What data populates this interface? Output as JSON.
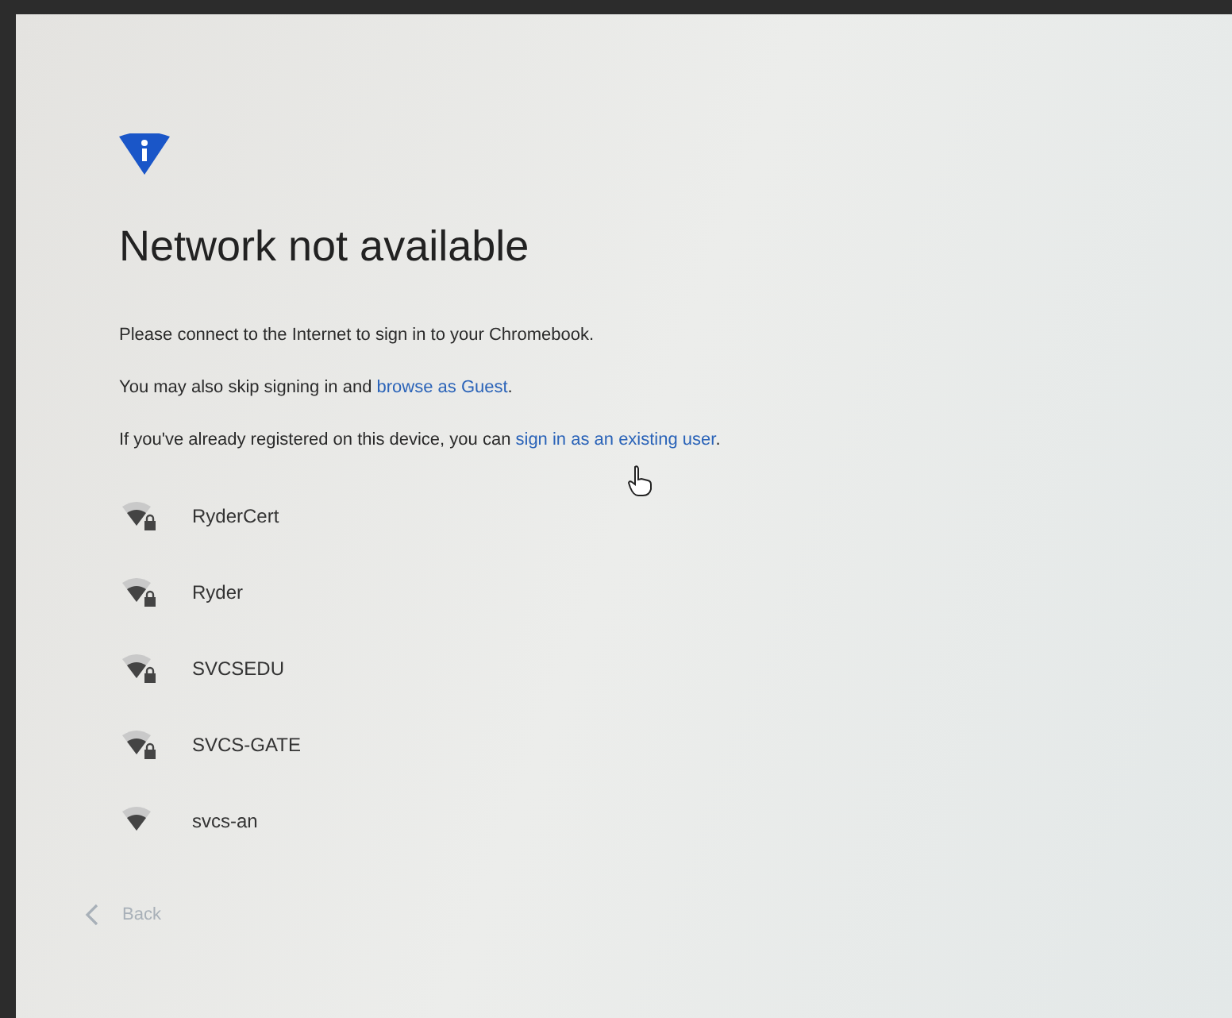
{
  "title": "Network not available",
  "paragraphs": [
    {
      "text": "Please connect to the Internet to sign in to your Chromebook."
    },
    {
      "text": "You may also skip signing in and ",
      "link": "browse as Guest",
      "after": "."
    },
    {
      "text": "If you've already registered on this device, you can ",
      "link": "sign in as an existing user",
      "after": "."
    }
  ],
  "networks": [
    {
      "name": "RyderCert",
      "secured": true
    },
    {
      "name": "Ryder",
      "secured": true
    },
    {
      "name": "SVCSEDU",
      "secured": true
    },
    {
      "name": "SVCS-GATE",
      "secured": true
    },
    {
      "name": "svcs-an",
      "secured": false
    }
  ],
  "back_button": {
    "label": "Back",
    "disabled": true
  }
}
